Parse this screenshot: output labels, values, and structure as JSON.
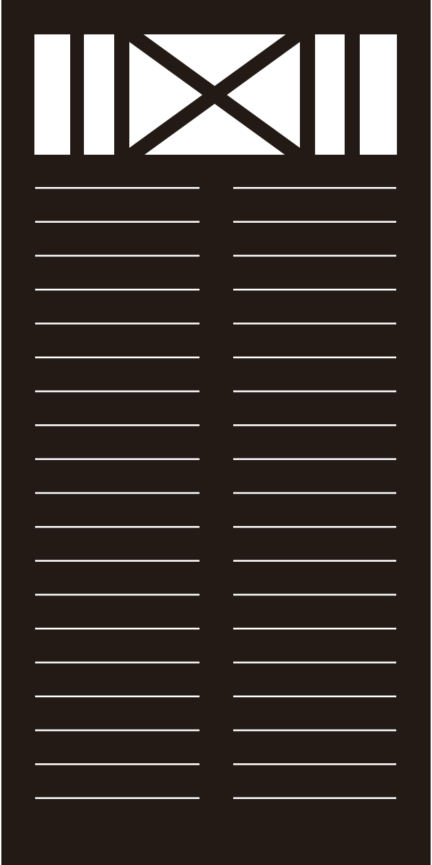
{
  "image": {
    "subject": "fence-panel",
    "frame_color": "#231a16",
    "gap_color": "#ffffff",
    "top_section": {
      "lattice": "cross",
      "vertical_slats_per_side": 2
    },
    "lower_section": {
      "columns": 2,
      "horizontal_gaps_per_column": 19
    }
  }
}
